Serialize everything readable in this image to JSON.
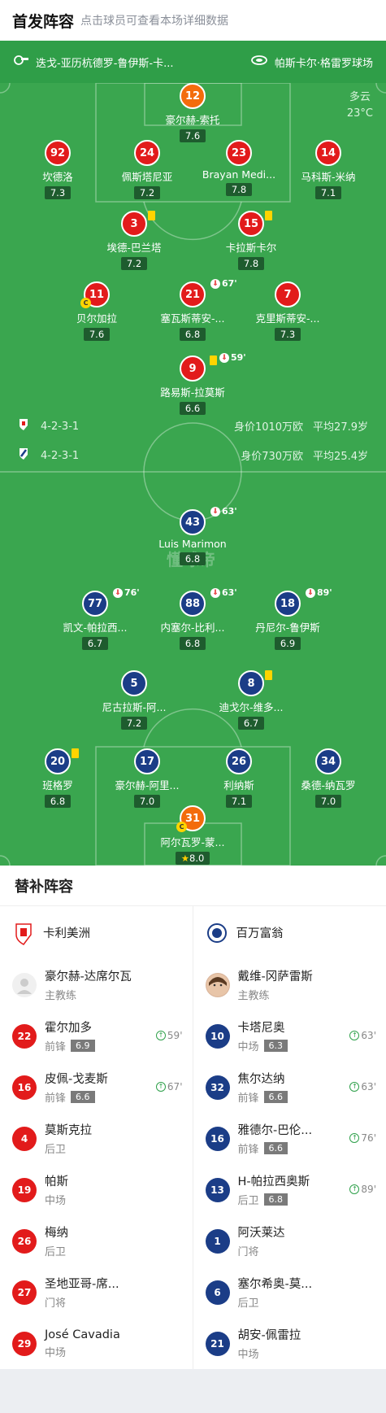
{
  "header": {
    "title": "首发阵容",
    "subtitle": "点击球员可查看本场详细数据"
  },
  "infobar": {
    "referee": "迭戈-亚历杭德罗-鲁伊斯-卡...",
    "stadium": "帕斯卡尔·格雷罗球场"
  },
  "weather": {
    "condition": "多云",
    "temp": "23°C"
  },
  "watermark": "懂球帝",
  "home_formation": {
    "formation": "4-2-3-1",
    "value": "身价1010万欧",
    "avg_age": "平均27.9岁"
  },
  "away_formation": {
    "formation": "4-2-3-1",
    "value": "身价730万欧",
    "avg_age": "平均25.4岁"
  },
  "home_players": [
    {
      "num": "12",
      "name": "豪尔赫-索托",
      "rating": "7.6"
    },
    {
      "num": "92",
      "name": "坎德洛",
      "rating": "7.3"
    },
    {
      "num": "24",
      "name": "佩斯塔尼亚",
      "rating": "7.2"
    },
    {
      "num": "23",
      "name": "Brayan Medi...",
      "rating": "7.8"
    },
    {
      "num": "14",
      "name": "马科斯-米纳",
      "rating": "7.1"
    },
    {
      "num": "3",
      "name": "埃德-巴兰塔",
      "rating": "7.2"
    },
    {
      "num": "15",
      "name": "卡拉斯卡尔",
      "rating": "7.8"
    },
    {
      "num": "11",
      "name": "贝尔加拉",
      "rating": "7.6"
    },
    {
      "num": "21",
      "name": "塞瓦斯蒂安-...",
      "rating": "6.8",
      "sub": "67'"
    },
    {
      "num": "7",
      "name": "克里斯蒂安-...",
      "rating": "7.3"
    },
    {
      "num": "9",
      "name": "路易斯-拉莫斯",
      "rating": "6.6",
      "sub": "59'"
    }
  ],
  "away_players": [
    {
      "num": "43",
      "name": "Luis Marimon",
      "rating": "6.8",
      "sub": "63'"
    },
    {
      "num": "77",
      "name": "凯文-帕拉西...",
      "rating": "6.7",
      "sub": "76'"
    },
    {
      "num": "88",
      "name": "内塞尔-比利...",
      "rating": "6.8",
      "sub": "63'"
    },
    {
      "num": "18",
      "name": "丹尼尔-鲁伊斯",
      "rating": "6.9",
      "sub": "89'"
    },
    {
      "num": "5",
      "name": "尼古拉斯-阿...",
      "rating": "7.2"
    },
    {
      "num": "8",
      "name": "迪戈尔-维多...",
      "rating": "6.7"
    },
    {
      "num": "20",
      "name": "班格罗",
      "rating": "6.8"
    },
    {
      "num": "17",
      "name": "豪尔赫-阿里...",
      "rating": "7.0"
    },
    {
      "num": "26",
      "name": "利纳斯",
      "rating": "7.1"
    },
    {
      "num": "34",
      "name": "桑德-纳瓦罗",
      "rating": "7.0"
    },
    {
      "num": "31",
      "name": "阿尔瓦罗-蒙...",
      "rating": "8.0"
    }
  ],
  "captain_mark": "C",
  "bench": {
    "title": "替补阵容",
    "home_team": "卡利美洲",
    "away_team": "百万富翁",
    "home_coach": {
      "name": "豪尔赫-达席尔瓦",
      "role": "主教练"
    },
    "away_coach": {
      "name": "戴维-冈萨雷斯",
      "role": "主教练"
    },
    "home": [
      {
        "num": "22",
        "name": "霍尔加多",
        "pos": "前锋",
        "rating": "6.9",
        "sub": "59'"
      },
      {
        "num": "16",
        "name": "皮佩-戈麦斯",
        "pos": "前锋",
        "rating": "6.6",
        "sub": "67'"
      },
      {
        "num": "4",
        "name": "莫斯克拉",
        "pos": "后卫"
      },
      {
        "num": "19",
        "name": "帕斯",
        "pos": "中场"
      },
      {
        "num": "26",
        "name": "梅纳",
        "pos": "后卫"
      },
      {
        "num": "27",
        "name": "圣地亚哥-席...",
        "pos": "门将"
      },
      {
        "num": "29",
        "name": "José Cavadia",
        "pos": "中场"
      }
    ],
    "away": [
      {
        "num": "10",
        "name": "卡塔尼奥",
        "pos": "中场",
        "rating": "6.3",
        "sub": "63'"
      },
      {
        "num": "32",
        "name": "焦尔达纳",
        "pos": "前锋",
        "rating": "6.6",
        "sub": "63'"
      },
      {
        "num": "16",
        "name": "雅德尔-巴伦...",
        "pos": "前锋",
        "rating": "6.6",
        "sub": "76'"
      },
      {
        "num": "13",
        "name": "H-帕拉西奥斯",
        "pos": "后卫",
        "rating": "6.8",
        "sub": "89'"
      },
      {
        "num": "1",
        "name": "阿沃莱达",
        "pos": "门将"
      },
      {
        "num": "6",
        "name": "塞尔希奥-莫...",
        "pos": "后卫"
      },
      {
        "num": "21",
        "name": "胡安-佩雷拉",
        "pos": "中场"
      }
    ]
  },
  "colors": {
    "home": "#e21b1b",
    "away": "#1b3d87",
    "goalkeeper": "#f36c0c",
    "pitch": "#3aa64f"
  }
}
